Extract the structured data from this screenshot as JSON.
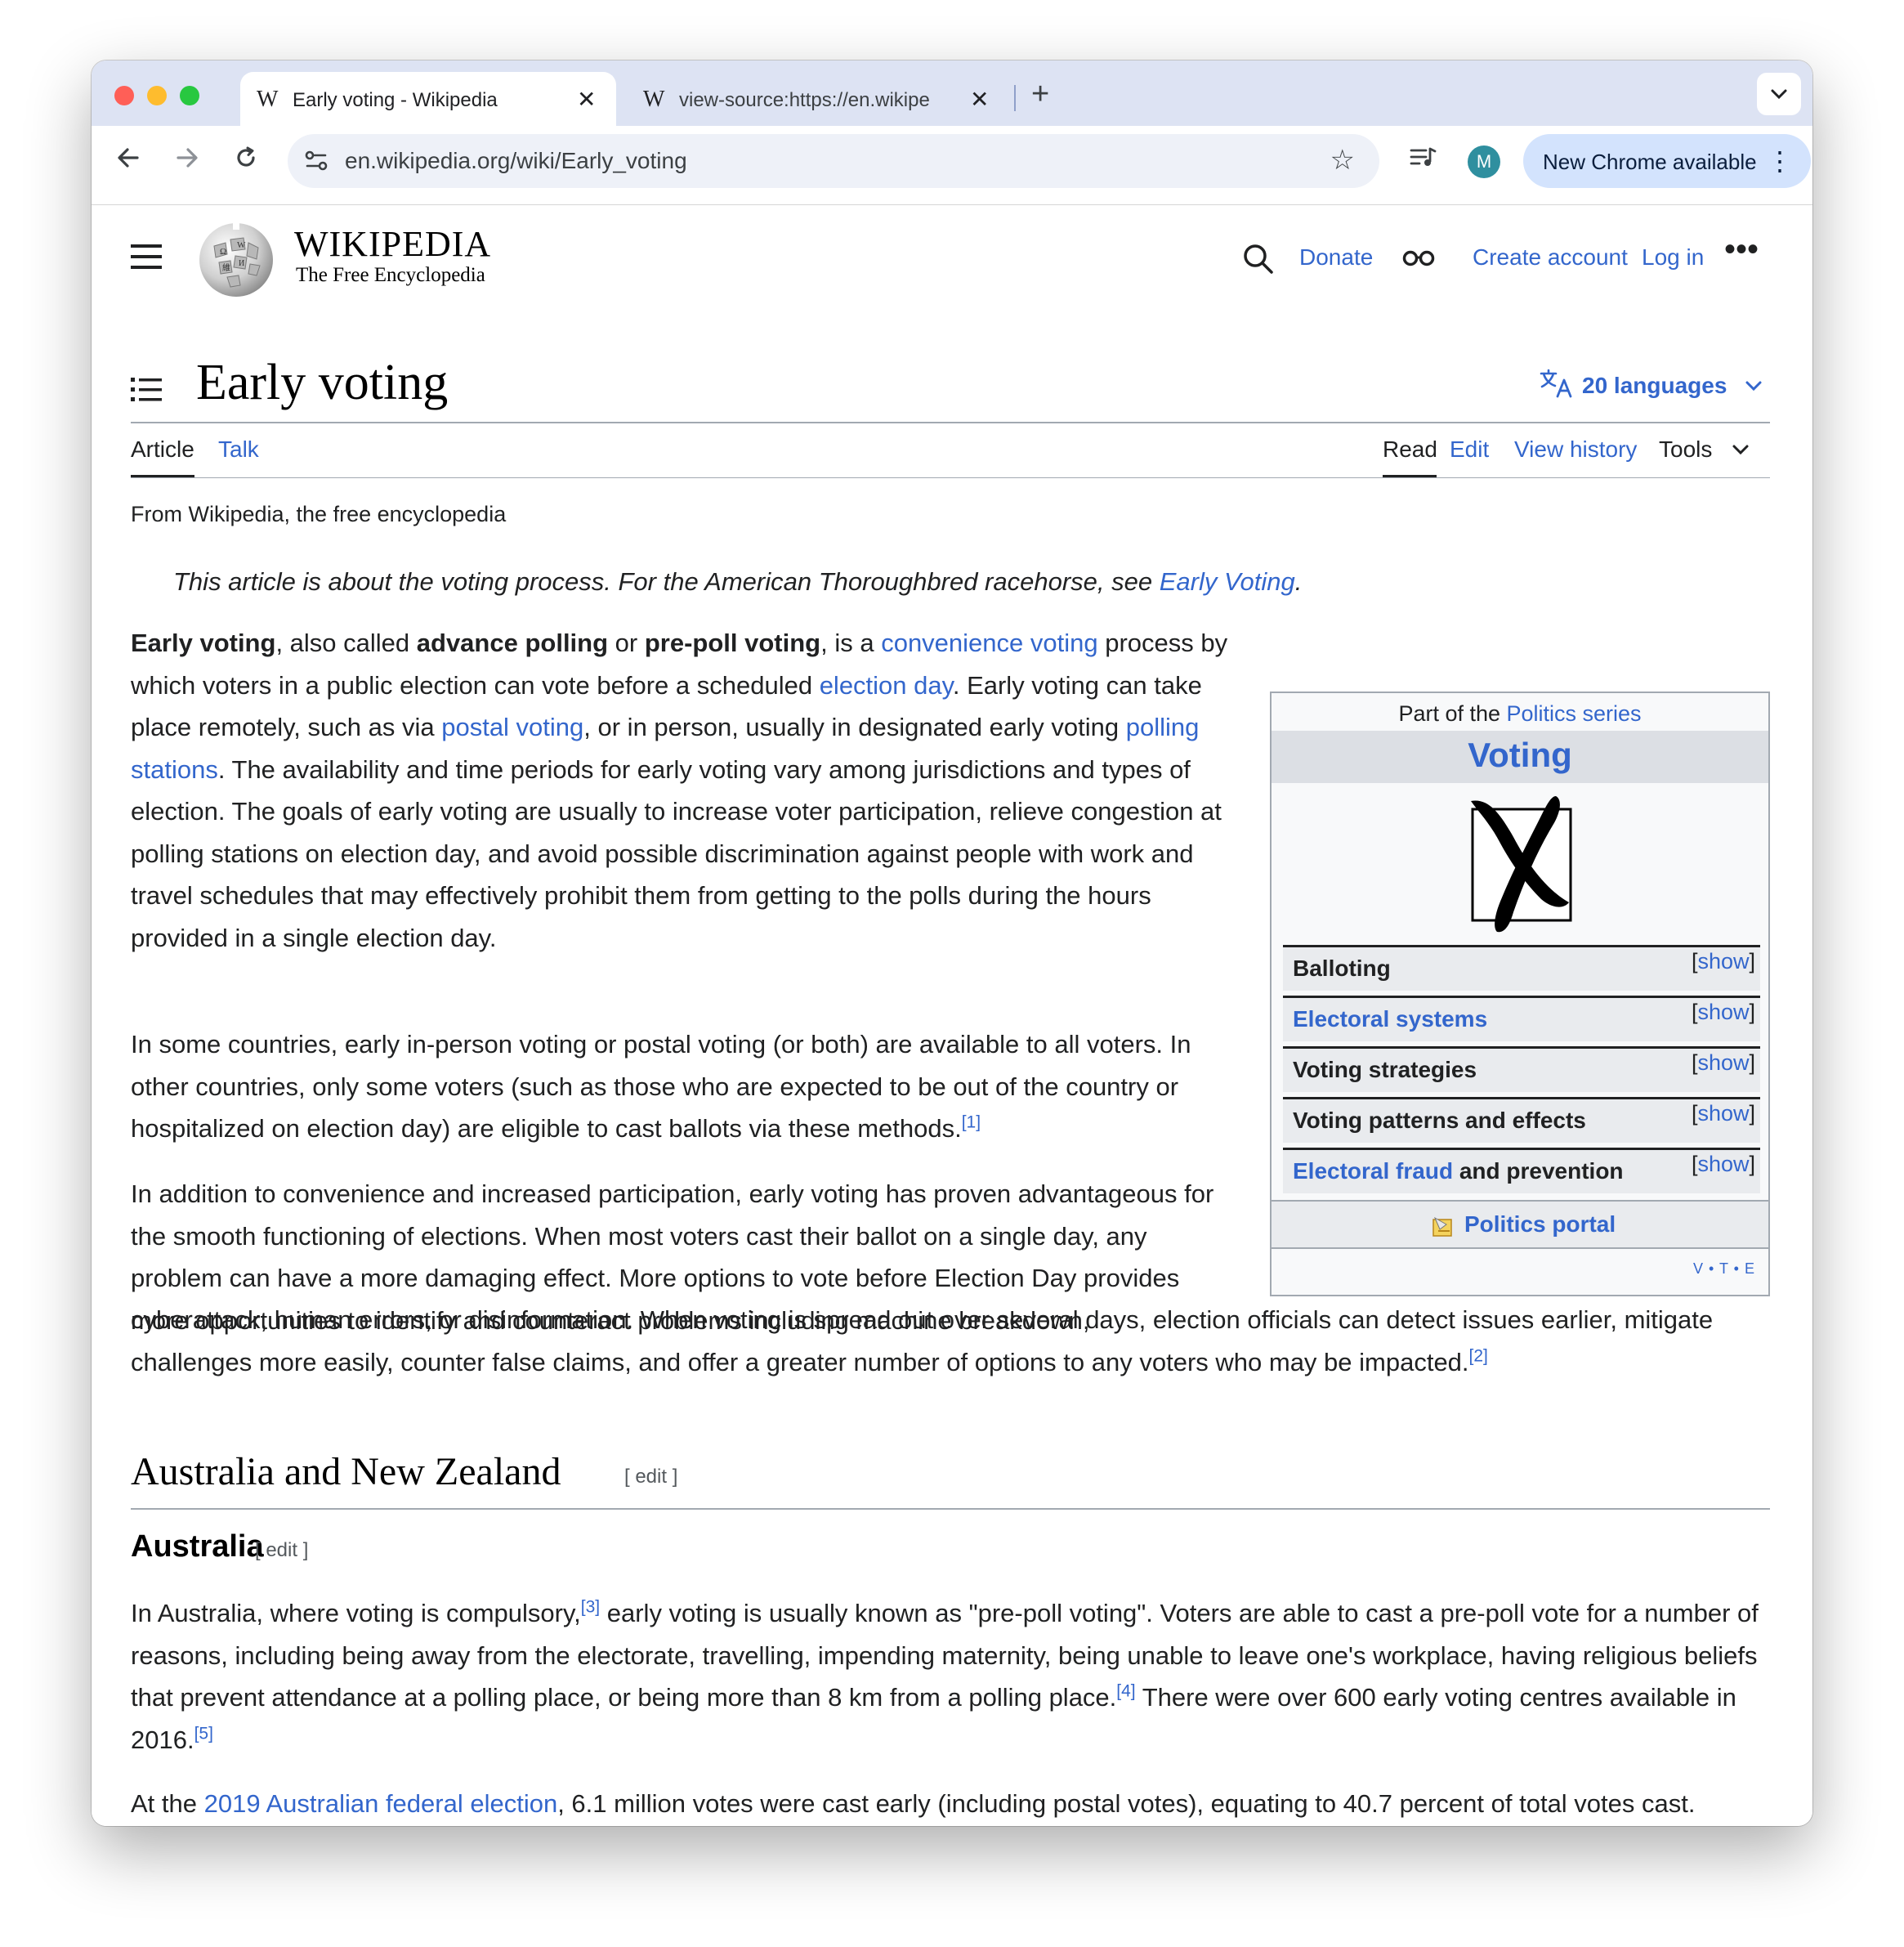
{
  "browser": {
    "tabs": [
      {
        "favicon": "W",
        "title": "Early voting - Wikipedia",
        "close": "✕"
      },
      {
        "favicon": "W",
        "title": "view-source:https://en.wikipe",
        "close": "✕"
      }
    ],
    "new_tab": "+",
    "tab_menu": "⌄",
    "url": "en.wikipedia.org/wiki/Early_voting",
    "profile_initial": "M",
    "update_label": "New Chrome available"
  },
  "header": {
    "wordmark": "WIKIPEDIA",
    "tagline": "The Free Encyclopedia",
    "donate": "Donate",
    "create_account": "Create account",
    "log_in": "Log in",
    "more": "•••"
  },
  "article": {
    "title": "Early voting",
    "languages": "20 languages",
    "tabs": {
      "article": "Article",
      "talk": "Talk",
      "read": "Read",
      "edit": "Edit",
      "view_history": "View history",
      "tools": "Tools"
    },
    "tagline": "From Wikipedia, the free encyclopedia",
    "hatnote": {
      "text": "This article is about the voting process. For the American Thoroughbred racehorse, see ",
      "link": "Early Voting",
      "end": "."
    },
    "p1": {
      "b1": "Early voting",
      "t1": ", also called ",
      "b2": "advance polling",
      "t2": " or ",
      "b3": "pre-poll voting",
      "t3": ", is a ",
      "l1": "convenience voting",
      "t4": " process by which voters in a public election can vote before a scheduled ",
      "l2": "election day",
      "t5": ". Early voting can take place remotely, such as via ",
      "l3": "postal voting",
      "t6": ", or in person, usually in designated early voting ",
      "l4": "polling stations",
      "t7": ". The availability and time periods for early voting vary among jurisdictions and types of election. The goals of early voting are usually to increase voter participation, relieve congestion at polling stations on election day, and avoid possible discrimination against people with work and travel schedules that may effectively prohibit them from getting to the polls during the hours provided in a single election day."
    },
    "p2": {
      "text": "In some countries, early in-person voting or postal voting (or both) are available to all voters. In other countries, only some voters (such as those who are expected to be out of the country or hospitalized on election day) are eligible to cast ballots via these methods.",
      "ref": "[1]"
    },
    "p3a": "In addition to convenience and increased participation, early voting has proven advantageous for the smooth functioning of elections. When most voters cast their ballot on a single day, any problem can have a more damaging effect. More options to vote before Election Day provides more opportunities to identify and counteract problems including machine breakdown,",
    "p3b": {
      "text": "cyberattack, human errors, or disinformation. When voting is spread out over several days, election officials can detect issues earlier, mitigate challenges more easily, counter false claims, and offer a greater number of options to any voters who may be impacted.",
      "ref": "[2]"
    },
    "section_australia_nz": {
      "heading": "Australia and New Zealand",
      "edit": "[ edit ]"
    },
    "section_australia": {
      "heading": "Australia",
      "edit": "[ edit ]"
    },
    "p4": {
      "t1": "In Australia, where voting is compulsory,",
      "r1": "[3]",
      "t2": " early voting is usually known as \"pre-poll voting\". Voters are able to cast a pre-poll vote for a number of reasons, including being away from the electorate, travelling, impending maternity, being unable to leave one's workplace, having religious beliefs that prevent attendance at a polling place, or being more than 8 km from a polling place.",
      "r2": "[4]",
      "t3": " There were over 600 early voting centres available in 2016.",
      "r3": "[5]"
    },
    "p5": {
      "t1": "At the ",
      "l1": "2019 Australian federal election",
      "t2": ", 6.1 million votes were cast early (including postal votes), equating to 40.7 percent of total votes cast."
    }
  },
  "infobox": {
    "above_text": "Part of the ",
    "above_link": "Politics series",
    "title": "Voting",
    "rows": [
      {
        "label": "Balloting",
        "is_link": false,
        "show": "show"
      },
      {
        "label": "Electoral systems",
        "is_link": true,
        "show": "show"
      },
      {
        "label": "Voting strategies",
        "is_link": false,
        "show": "show"
      },
      {
        "label": "Voting patterns and effects",
        "is_link": false,
        "show": "show"
      },
      {
        "label": "Electoral fraud",
        "suffix": " and prevention",
        "is_link": true,
        "show": "show"
      }
    ],
    "portal": "Politics portal",
    "vte": {
      "v": "V",
      "t": "T",
      "e": "E"
    }
  },
  "colors": {
    "link": "#3366cc",
    "text": "#202122",
    "chrome_tabstrip": "#dde3f3",
    "update_button": "#d3e3fd"
  },
  "icons": [
    "back-arrow-icon",
    "forward-arrow-icon",
    "reload-icon",
    "site-info-icon",
    "bookmark-star-icon",
    "media-control-icon",
    "hamburger-menu-icon",
    "search-icon",
    "reading-glasses-icon",
    "toc-icon",
    "translate-icon",
    "chevron-down-icon",
    "ballot-x-icon",
    "portal-icon"
  ]
}
